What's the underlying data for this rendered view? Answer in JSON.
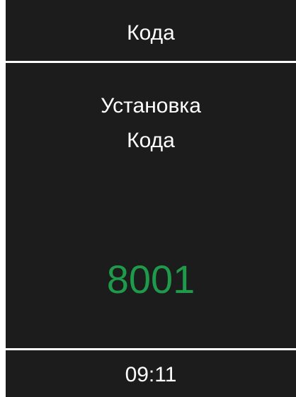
{
  "header": {
    "title": "Кода"
  },
  "message": {
    "line1": "Установка",
    "line2": "Кода"
  },
  "code": {
    "value": "8001",
    "color": "#1e9a4a"
  },
  "footer": {
    "time": "09:11"
  },
  "colors": {
    "background": "#1c1c1c",
    "text": "#ffffff",
    "divider": "#ffffff"
  }
}
